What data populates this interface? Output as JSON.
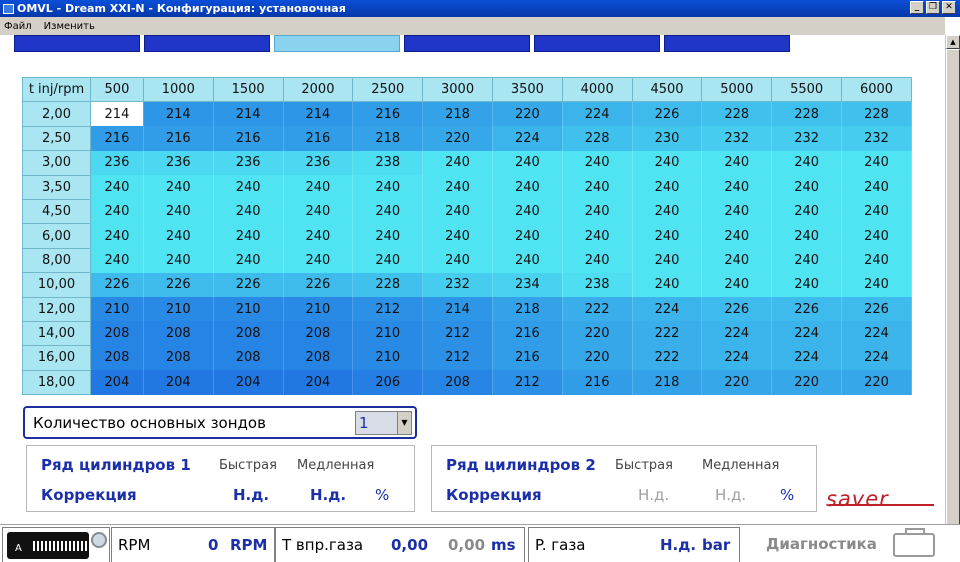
{
  "window": {
    "title": "OMVL - Dream XXI-N - Конфигурация: установочная",
    "buttons": [
      "_",
      "❐",
      "✕"
    ]
  },
  "menu": [
    "Файл",
    "Изменить"
  ],
  "tabs": [
    "",
    "",
    "",
    "",
    "",
    ""
  ],
  "table": {
    "corner": "t inj/rpm",
    "columns": [
      "500",
      "1000",
      "1500",
      "2000",
      "2500",
      "3000",
      "3500",
      "4000",
      "4500",
      "5000",
      "5500",
      "6000"
    ],
    "rows": [
      {
        "label": "2,00",
        "values": [
          "214",
          "214",
          "214",
          "214",
          "216",
          "218",
          "220",
          "224",
          "226",
          "228",
          "228",
          "228"
        ]
      },
      {
        "label": "2,50",
        "values": [
          "216",
          "216",
          "216",
          "216",
          "218",
          "220",
          "224",
          "228",
          "230",
          "232",
          "232",
          "232"
        ]
      },
      {
        "label": "3,00",
        "values": [
          "236",
          "236",
          "236",
          "236",
          "238",
          "240",
          "240",
          "240",
          "240",
          "240",
          "240",
          "240"
        ]
      },
      {
        "label": "3,50",
        "values": [
          "240",
          "240",
          "240",
          "240",
          "240",
          "240",
          "240",
          "240",
          "240",
          "240",
          "240",
          "240"
        ]
      },
      {
        "label": "4,50",
        "values": [
          "240",
          "240",
          "240",
          "240",
          "240",
          "240",
          "240",
          "240",
          "240",
          "240",
          "240",
          "240"
        ]
      },
      {
        "label": "6,00",
        "values": [
          "240",
          "240",
          "240",
          "240",
          "240",
          "240",
          "240",
          "240",
          "240",
          "240",
          "240",
          "240"
        ]
      },
      {
        "label": "8,00",
        "values": [
          "240",
          "240",
          "240",
          "240",
          "240",
          "240",
          "240",
          "240",
          "240",
          "240",
          "240",
          "240"
        ]
      },
      {
        "label": "10,00",
        "values": [
          "226",
          "226",
          "226",
          "226",
          "228",
          "232",
          "234",
          "238",
          "240",
          "240",
          "240",
          "240"
        ]
      },
      {
        "label": "12,00",
        "values": [
          "210",
          "210",
          "210",
          "210",
          "212",
          "214",
          "218",
          "222",
          "224",
          "226",
          "226",
          "226"
        ]
      },
      {
        "label": "14,00",
        "values": [
          "208",
          "208",
          "208",
          "208",
          "210",
          "212",
          "216",
          "220",
          "222",
          "224",
          "224",
          "224"
        ]
      },
      {
        "label": "16,00",
        "values": [
          "208",
          "208",
          "208",
          "208",
          "210",
          "212",
          "216",
          "220",
          "222",
          "224",
          "224",
          "224"
        ]
      },
      {
        "label": "18,00",
        "values": [
          "204",
          "204",
          "204",
          "204",
          "206",
          "208",
          "212",
          "216",
          "218",
          "220",
          "220",
          "220"
        ]
      }
    ]
  },
  "probes": {
    "label": "Количество основных зондов",
    "value": "1"
  },
  "bank1": {
    "title": "Ряд цилиндров 1",
    "fast": "Быстрая",
    "slow": "Медленная",
    "correction": "Коррекция",
    "fast_value": "Н.д.",
    "slow_value": "Н.д.",
    "unit": "%"
  },
  "bank2": {
    "title": "Ряд цилиндров 2",
    "fast": "Быстрая",
    "slow": "Медленная",
    "correction": "Коррекция",
    "fast_value": "Н.д.",
    "slow_value": "Н.д.",
    "unit": "%"
  },
  "logo": "saver",
  "status": {
    "chip_label": "A",
    "rpm_label": "RPM",
    "rpm_value": "0",
    "rpm_unit": "RPM",
    "inj_label": "T впр.газа",
    "inj_value1": "0,00",
    "inj_value2": "0,00",
    "inj_unit": "ms",
    "gas_label": "P. газа",
    "gas_value": "Н.д.",
    "gas_unit": "bar",
    "diag_label": "Диагностика"
  }
}
